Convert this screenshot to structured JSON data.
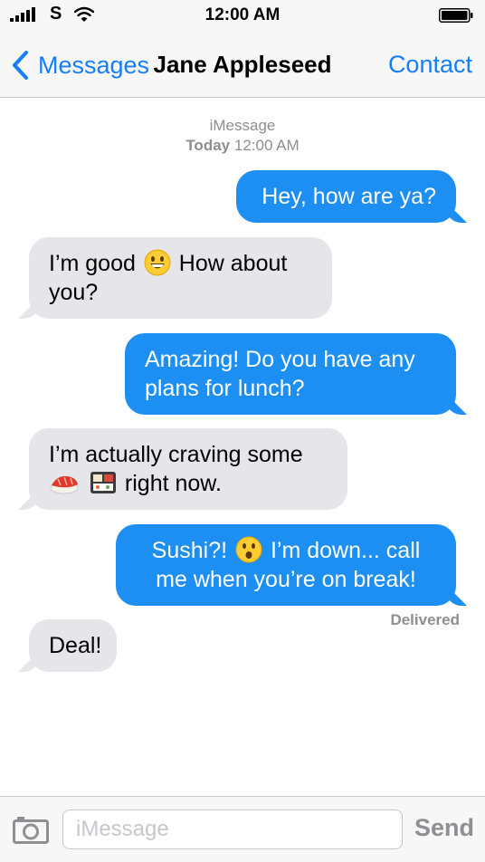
{
  "status_bar": {
    "carrier_glyph": "S",
    "time": "12:00 AM"
  },
  "nav": {
    "back_label": "Messages",
    "title": "Jane Appleseed",
    "right_label": "Contact"
  },
  "thread": {
    "service": "iMessage",
    "day": "Today",
    "time": "12:00 AM"
  },
  "messages": [
    {
      "direction": "outgoing",
      "text": "Hey, how are ya?"
    },
    {
      "direction": "incoming",
      "line1_a": "I’m good",
      "emoji": "grinning-face",
      "line1_b": "How about",
      "line2": "you?"
    },
    {
      "direction": "outgoing",
      "line1": "Amazing! Do you have any",
      "line2": "plans for lunch?"
    },
    {
      "direction": "incoming",
      "line1": "I’m actually craving some",
      "emojis": [
        "sushi",
        "bento-box"
      ],
      "line2": "right now."
    },
    {
      "direction": "outgoing",
      "line1_a": "Sushi?!",
      "emoji": "astonished-face",
      "line1_b": "I’m down... call",
      "line2": "me when you’re on break!"
    },
    {
      "direction": "incoming",
      "text": "Deal!"
    }
  ],
  "delivered_label": "Delivered",
  "composer": {
    "placeholder": "iMessage",
    "value": "",
    "send_label": "Send"
  },
  "colors": {
    "accent": "#157efb",
    "outgoing_bubble": "#1d8ef2",
    "incoming_bubble": "#e5e5ea",
    "secondary_text": "#8e8e93"
  },
  "icons": [
    "signal-bars-icon",
    "wifi-icon",
    "battery-icon",
    "chevron-left-icon",
    "camera-icon"
  ]
}
